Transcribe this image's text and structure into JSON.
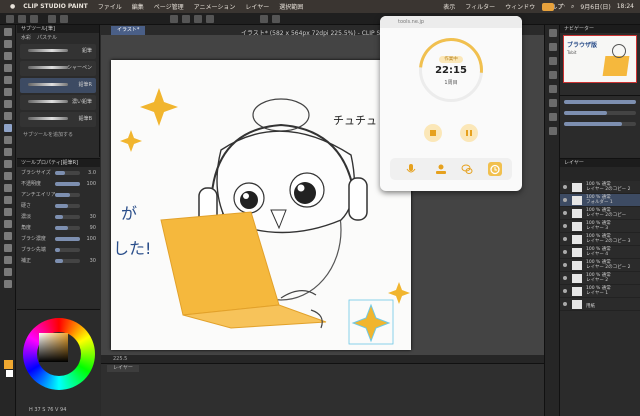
{
  "menubar": {
    "app": "CLIP STUDIO PAINT",
    "items": [
      "ファイル",
      "編集",
      "ページ管理",
      "アニメーション",
      "レイヤー",
      "選択範囲",
      "表示",
      "フィルター",
      "ウィンドウ",
      "ヘルプ"
    ],
    "date": "9月6日(日)",
    "time": "18:24"
  },
  "subtool": {
    "title": "サブツール[筆]",
    "tabs": [
      "水彩",
      "パステル"
    ],
    "brushes": [
      "鉛筆",
      "シャーペン",
      "鉛筆R",
      "濃い鉛筆",
      "鉛筆B"
    ],
    "add_label": "サブツールを追加する"
  },
  "toolprop": {
    "title": "ツールプロパティ[鉛筆R]",
    "rows": [
      {
        "name": "ブラシサイズ",
        "pct": 0.4,
        "value": "3.0"
      },
      {
        "name": "不透明度",
        "pct": 1.0,
        "value": "100"
      },
      {
        "name": "アンチエイリアス",
        "pct": 0.6,
        "value": ""
      },
      {
        "name": "硬さ",
        "pct": 0.5,
        "value": ""
      },
      {
        "name": "濃淡",
        "pct": 0.3,
        "value": "30"
      },
      {
        "name": "角度",
        "pct": 0.5,
        "value": "90"
      },
      {
        "name": "ブラシ濃度",
        "pct": 1.0,
        "value": "100"
      },
      {
        "name": "ブラシ先端",
        "pct": 0.2,
        "value": ""
      },
      {
        "name": "補正",
        "pct": 0.3,
        "value": "30"
      }
    ]
  },
  "color": {
    "main": "#f0a830",
    "values": "H 37  S 76  V 94"
  },
  "canvas": {
    "doc_tab": "イラスト*",
    "doc_title": "イラスト* (582 x 564px 72dpi 225.5%) - CLIP STUDIO PAINT",
    "zoom": "225.5",
    "handwriting_1": "チュチュ",
    "handwriting_2": "が",
    "handwriting_3": "した!"
  },
  "bottom_panel": {
    "tab": "レイヤー"
  },
  "navigator": {
    "title": "ナビゲーター",
    "thumb_text": "ブラウザ版",
    "thumb_sub": "Tobit"
  },
  "layers": {
    "title": "レイヤー",
    "rows": [
      {
        "line1": "100 % 通常",
        "line2": "レイヤー 2のコピー 2",
        "selected": false
      },
      {
        "line1": "100 % 通常",
        "line2": "フォルダー 1",
        "selected": true
      },
      {
        "line1": "100 % 通常",
        "line2": "レイヤー 2のコピー",
        "selected": false
      },
      {
        "line1": "100 % 通常",
        "line2": "レイヤー 3",
        "selected": false
      },
      {
        "line1": "100 % 通常",
        "line2": "レイヤー 2のコピー 3",
        "selected": false
      },
      {
        "line1": "100 % 通常",
        "line2": "レイヤー 4",
        "selected": false
      },
      {
        "line1": "100 % 通常",
        "line2": "レイヤー 2のコピー 2",
        "selected": false
      },
      {
        "line1": "100 % 通常",
        "line2": "レイヤー 2",
        "selected": false
      },
      {
        "line1": "100 % 通常",
        "line2": "レイヤー 1",
        "selected": false
      },
      {
        "line1": "",
        "line2": "用紙",
        "selected": false
      }
    ]
  },
  "timer": {
    "url": "tools.ne.jp",
    "status": "作業中",
    "clock": "22:15",
    "round": "1周目",
    "accent": "#f1c04f"
  }
}
